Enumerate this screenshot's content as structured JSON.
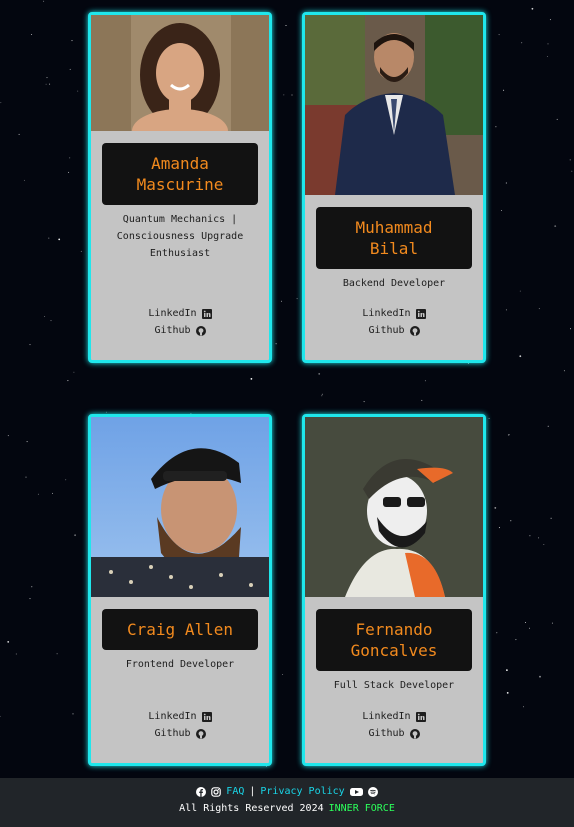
{
  "cards": [
    {
      "name": "Amanda Mascurine",
      "name_line1": "Amanda",
      "name_line2": "Mascurine",
      "role_line1": "Quantum Mechanics |",
      "role_line2": "Consciousness Upgrade",
      "role_line3": "Enthusiast",
      "linkedin": "LinkedIn",
      "github": "Github"
    },
    {
      "name": "Muhammad Bilal",
      "name_line1": "Muhammad",
      "name_line2": "Bilal",
      "role": "Backend Developer",
      "linkedin": "LinkedIn",
      "github": "Github"
    },
    {
      "name": "Craig Allen",
      "role": "Frontend Developer",
      "linkedin": "LinkedIn",
      "github": "Github"
    },
    {
      "name": "Fernando Goncalves",
      "name_line1": "Fernando",
      "name_line2": "Goncalves",
      "role": "Full Stack Developer",
      "linkedin": "LinkedIn",
      "github": "Github"
    }
  ],
  "footer": {
    "faq": "FAQ",
    "separator": "|",
    "privacy": "Privacy Policy",
    "rights": "All Rights Reserved 2024",
    "brand": "INNER FORCE"
  },
  "colors": {
    "accent": "#1fe7ec",
    "name_text": "#f28a1e",
    "brand": "#2cff5b",
    "link": "#19d6e8",
    "card_bg": "#c4c4c4"
  },
  "icons": [
    "linkedin-icon",
    "github-icon",
    "facebook-icon",
    "instagram-icon",
    "youtube-icon",
    "spotify-icon"
  ]
}
